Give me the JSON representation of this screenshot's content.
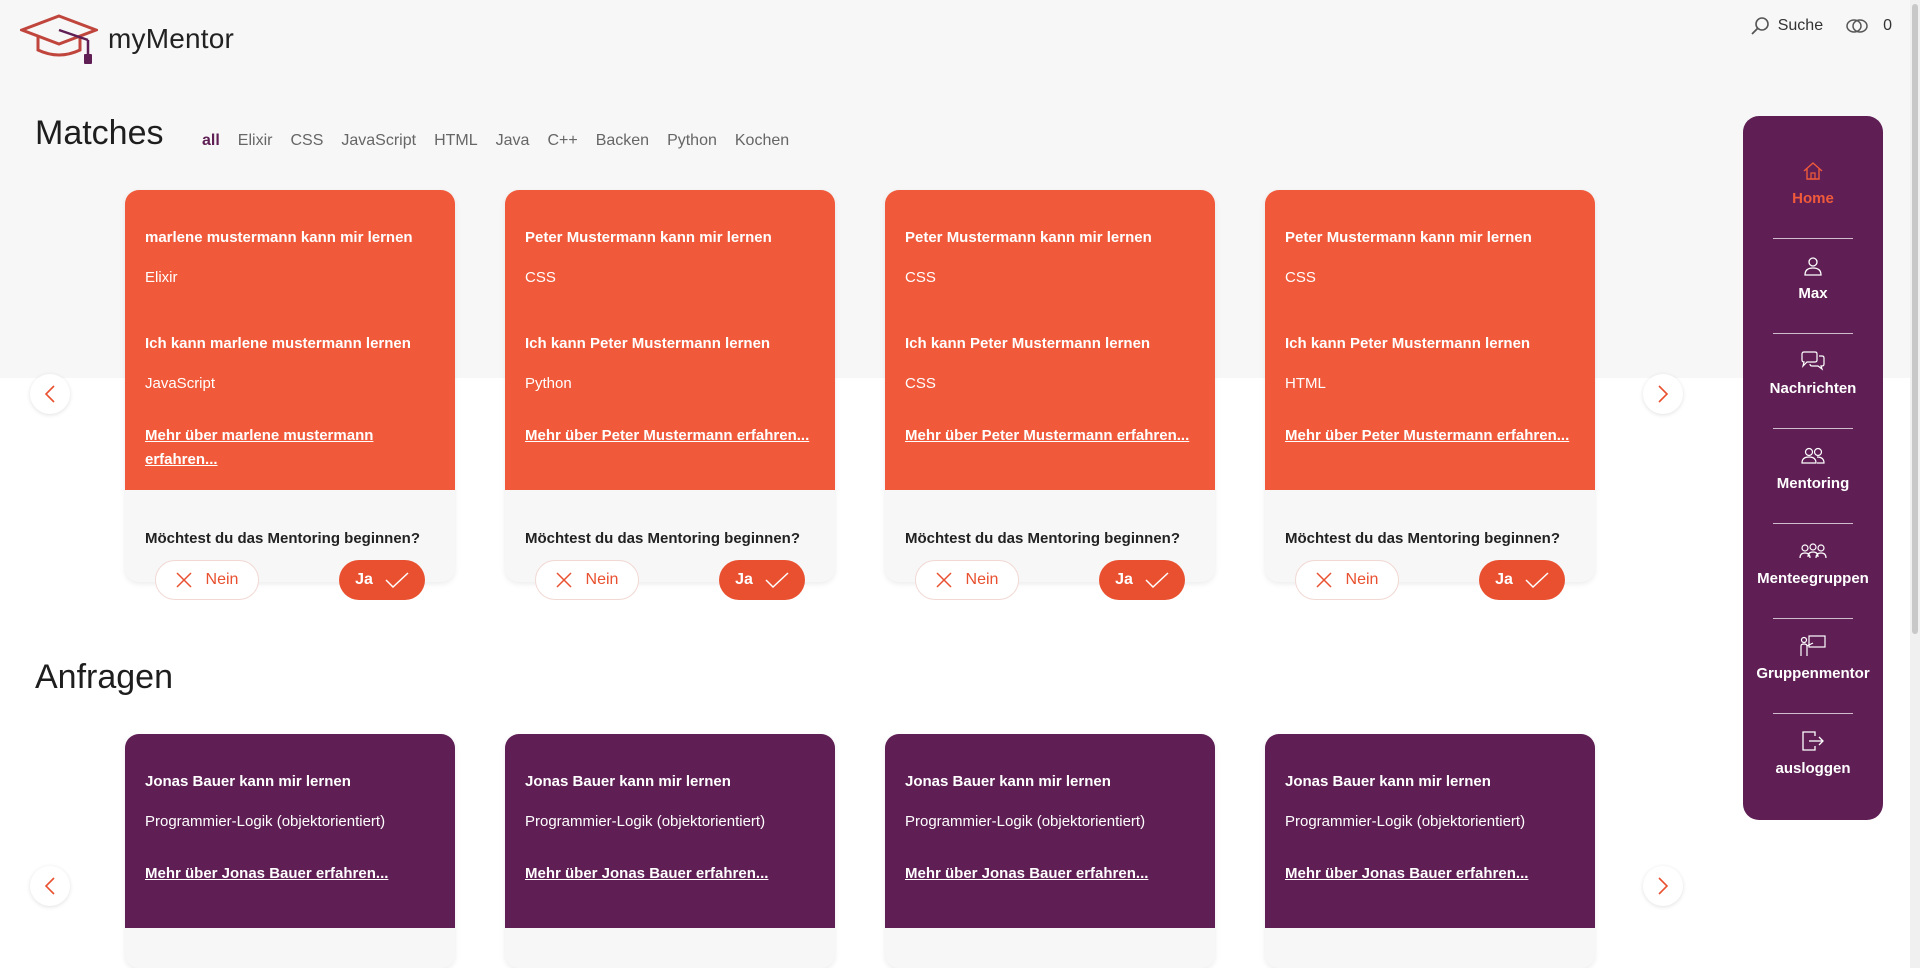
{
  "header": {
    "app_name": "myMentor",
    "search_label": "Suche",
    "coins_count": "0"
  },
  "matches": {
    "title": "Matches",
    "filters": [
      "all",
      "Elixir",
      "CSS",
      "JavaScript",
      "HTML",
      "Java",
      "C++",
      "Backen",
      "Python",
      "Kochen"
    ],
    "active_filter": "all",
    "question": "Möchtest du das Mentoring beginnen?",
    "no_label": "Nein",
    "yes_label": "Ja",
    "cards": [
      {
        "teach_line": "marlene mustermann kann mir lernen",
        "teach_topic": "Elixir",
        "learn_line": "Ich kann marlene mustermann lernen",
        "learn_topic": "JavaScript",
        "link": "Mehr über marlene mustermann erfahren..."
      },
      {
        "teach_line": "Peter Mustermann kann mir lernen",
        "teach_topic": "CSS",
        "learn_line": "Ich kann Peter Mustermann lernen",
        "learn_topic": "Python",
        "link": "Mehr über Peter Mustermann erfahren..."
      },
      {
        "teach_line": "Peter Mustermann kann mir lernen",
        "teach_topic": "CSS",
        "learn_line": "Ich kann Peter Mustermann lernen",
        "learn_topic": "CSS",
        "link": "Mehr über Peter Mustermann erfahren..."
      },
      {
        "teach_line": "Peter Mustermann kann mir lernen",
        "teach_topic": "CSS",
        "learn_line": "Ich kann Peter Mustermann lernen",
        "learn_topic": "HTML",
        "link": "Mehr über Peter Mustermann erfahren..."
      }
    ]
  },
  "requests": {
    "title": "Anfragen",
    "cards": [
      {
        "teach_line": "Jonas Bauer kann mir lernen",
        "teach_topic": "Programmier-Logik (objektorientiert)",
        "link": "Mehr über Jonas Bauer erfahren..."
      },
      {
        "teach_line": "Jonas Bauer kann mir lernen",
        "teach_topic": "Programmier-Logik (objektorientiert)",
        "link": "Mehr über Jonas Bauer erfahren..."
      },
      {
        "teach_line": "Jonas Bauer kann mir lernen",
        "teach_topic": "Programmier-Logik (objektorientiert)",
        "link": "Mehr über Jonas Bauer erfahren..."
      },
      {
        "teach_line": "Jonas Bauer kann mir lernen",
        "teach_topic": "Programmier-Logik (objektorientiert)",
        "link": "Mehr über Jonas Bauer erfahren..."
      }
    ]
  },
  "sidebar": {
    "items": [
      {
        "label": "Home",
        "icon": "home-icon",
        "active": true
      },
      {
        "label": "Max",
        "icon": "user-icon",
        "active": false
      },
      {
        "label": "Nachrichten",
        "icon": "chat-icon",
        "active": false
      },
      {
        "label": "Mentoring",
        "icon": "people-icon",
        "active": false
      },
      {
        "label": "Menteegruppen",
        "icon": "group-icon",
        "active": false
      },
      {
        "label": "Gruppenmentor",
        "icon": "presenter-icon",
        "active": false
      },
      {
        "label": "ausloggen",
        "icon": "logout-icon",
        "active": false
      }
    ]
  },
  "colors": {
    "accent": "#f05a3a",
    "brand": "#5f1f55"
  }
}
